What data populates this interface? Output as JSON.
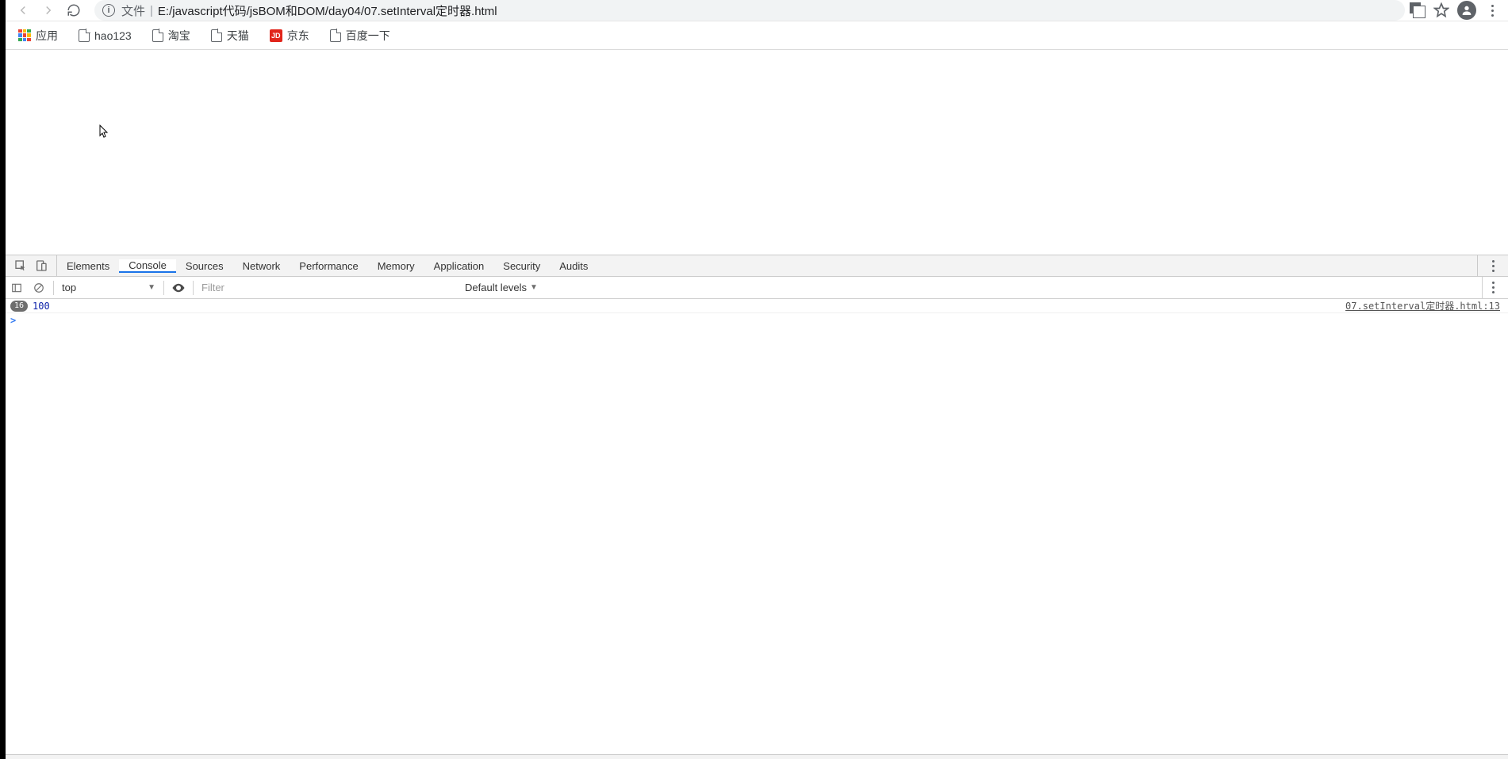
{
  "address": {
    "scheme_label": "文件",
    "separator": "|",
    "url": "E:/javascript代码/jsBOM和DOM/day04/07.setInterval定时器.html"
  },
  "bookmarks": {
    "apps_label": "应用",
    "items": [
      {
        "label": "hao123",
        "icon": "page"
      },
      {
        "label": "淘宝",
        "icon": "page"
      },
      {
        "label": "天猫",
        "icon": "page"
      },
      {
        "label": "京东",
        "icon": "jd"
      },
      {
        "label": "百度一下",
        "icon": "page"
      }
    ]
  },
  "devtools": {
    "tabs": [
      "Elements",
      "Console",
      "Sources",
      "Network",
      "Performance",
      "Memory",
      "Application",
      "Security",
      "Audits"
    ],
    "active_tab_index": 1,
    "console_toolbar": {
      "context": "top",
      "filter_placeholder": "Filter",
      "levels_label": "Default levels"
    },
    "log": {
      "count": "16",
      "message": "100",
      "source": "07.setInterval定时器.html:13"
    },
    "prompt": ">"
  }
}
